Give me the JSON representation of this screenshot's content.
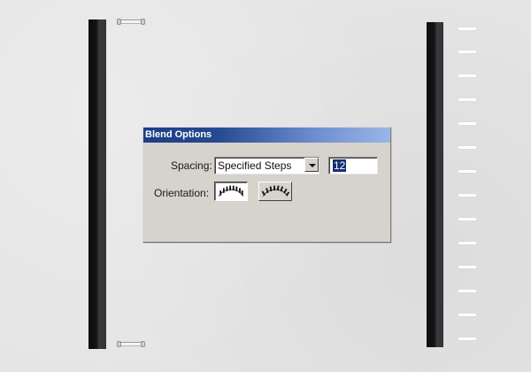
{
  "dialog": {
    "title": "Blend Options",
    "spacing_label": "Spacing:",
    "spacing_selected": "Specified Steps",
    "steps_value": "12",
    "orientation_label": "Orientation:",
    "orientation_icons": [
      "align-to-page-icon",
      "align-to-path-icon"
    ],
    "orientation_selected": "align-to-page"
  },
  "colors": {
    "canvas": "#e5e5e5",
    "bar_dark": "#141414",
    "dialog_face": "#d6d2cc",
    "title_gradient_start": "#1d3e84",
    "title_gradient_end": "#9ab6e5",
    "selection": "#16306f"
  },
  "blend": {
    "step_mark_count": 14,
    "icon_name": "step-mark-icon"
  }
}
